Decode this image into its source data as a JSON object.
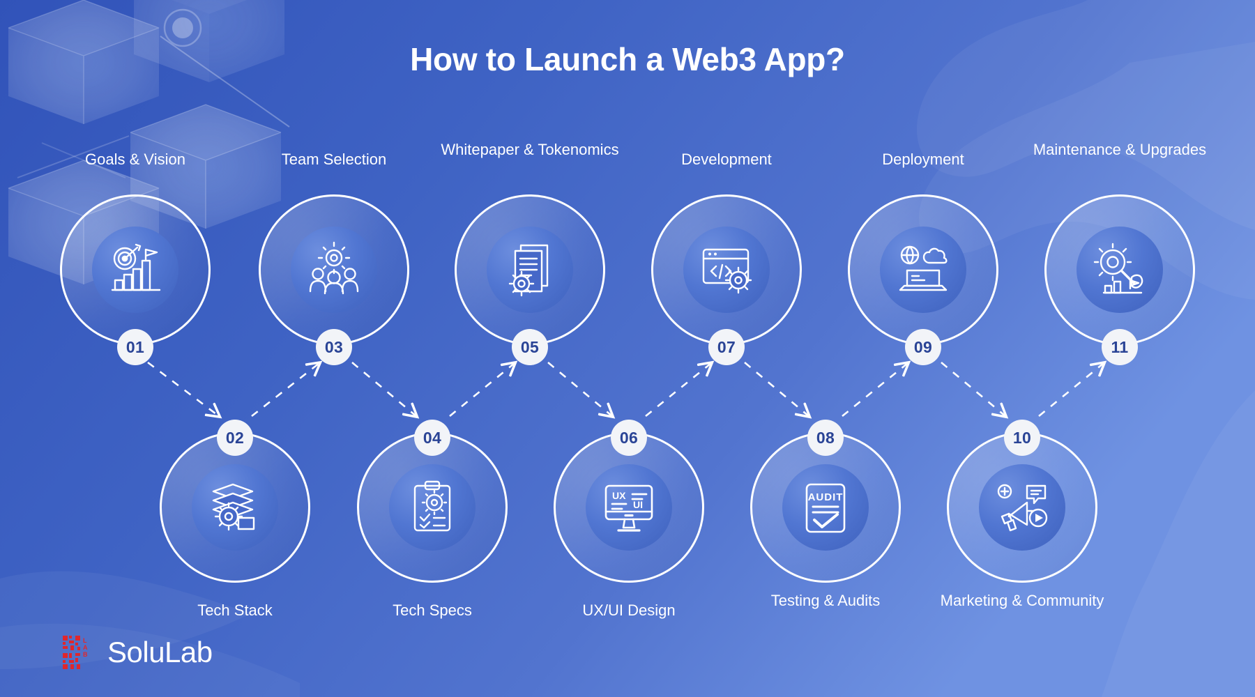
{
  "title": "How to Launch a Web3 App?",
  "brand": {
    "name": "SoluLab",
    "mark_top": "SOLU",
    "mark_bottom": "LAB",
    "mark_color": "#e0262c",
    "text_color": "#ffffff"
  },
  "colors": {
    "background_start": "#3558bd",
    "background_end": "#6b8ede",
    "circle_stroke": "#ffffff",
    "badge_bg": "#f2f4f8",
    "badge_text": "#2a4496",
    "label_text": "#ffffff",
    "connector": "#ffffff"
  },
  "steps": [
    {
      "number": "01",
      "label": "Goals & Vision",
      "row": "top",
      "icon": "target-growth-chart-icon"
    },
    {
      "number": "02",
      "label": "Tech Stack",
      "row": "bottom",
      "icon": "stacked-layers-gear-icon"
    },
    {
      "number": "03",
      "label": "Team Selection",
      "row": "top",
      "icon": "team-gear-icon"
    },
    {
      "number": "04",
      "label": "Tech Specs",
      "row": "bottom",
      "icon": "clipboard-gear-icon"
    },
    {
      "number": "05",
      "label": "Whitepaper & Tokenomics",
      "row": "top",
      "icon": "document-gear-icon"
    },
    {
      "number": "06",
      "label": "UX/UI Design",
      "row": "bottom",
      "icon": "monitor-uxui-icon"
    },
    {
      "number": "07",
      "label": "Development",
      "row": "top",
      "icon": "code-window-gear-icon"
    },
    {
      "number": "08",
      "label": "Testing & Audits",
      "row": "bottom",
      "icon": "audit-checklist-icon"
    },
    {
      "number": "09",
      "label": "Deployment",
      "row": "top",
      "icon": "laptop-cloud-globe-icon"
    },
    {
      "number": "10",
      "label": "Marketing & Community",
      "row": "bottom",
      "icon": "megaphone-social-icon"
    },
    {
      "number": "11",
      "label": "Maintenance & Upgrades",
      "row": "top",
      "icon": "gear-wrench-growth-icon"
    }
  ],
  "icon_text": {
    "ux": "UX",
    "ui": "UI",
    "audit": "AUDIT"
  }
}
